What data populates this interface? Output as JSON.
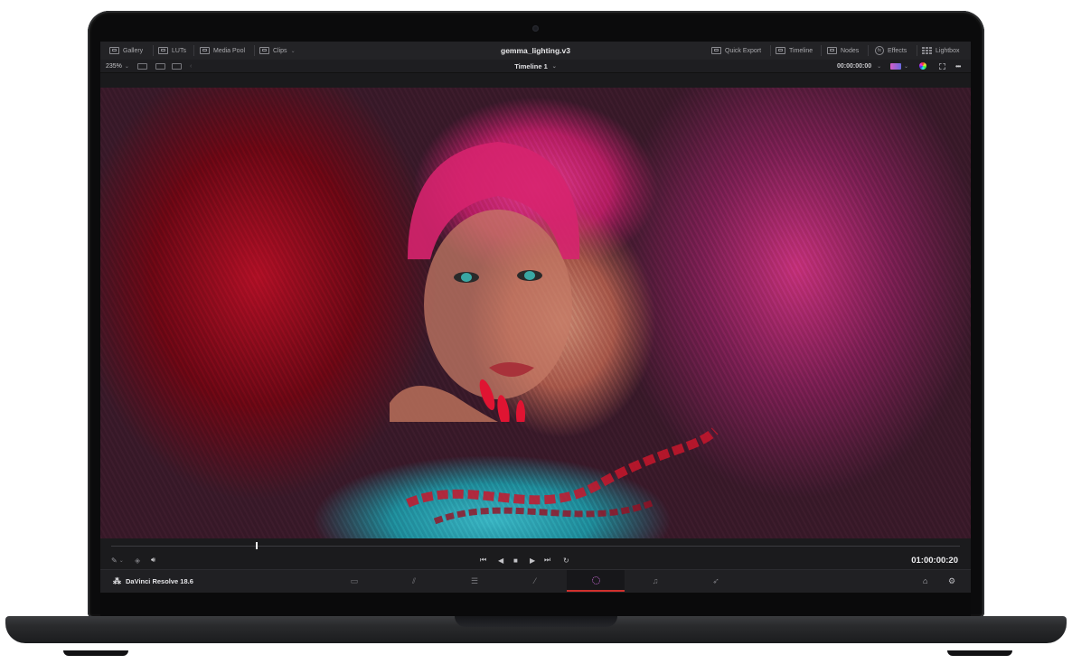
{
  "topbar": {
    "left_items": [
      {
        "label": "Gallery",
        "icon": "gallery-icon"
      },
      {
        "label": "LUTs",
        "icon": "luts-icon"
      },
      {
        "label": "Media Pool",
        "icon": "media-pool-icon"
      },
      {
        "label": "Clips",
        "icon": "clips-icon"
      }
    ],
    "project_title": "gemma_lighting.v3",
    "right_items": [
      {
        "label": "Quick Export",
        "icon": "quick-export-icon"
      },
      {
        "label": "Timeline",
        "icon": "timeline-icon"
      },
      {
        "label": "Nodes",
        "icon": "nodes-icon"
      },
      {
        "label": "Effects",
        "icon": "effects-icon"
      },
      {
        "label": "Lightbox",
        "icon": "lightbox-icon"
      }
    ]
  },
  "subbar": {
    "zoom": "235%",
    "timeline_name": "Timeline 1",
    "timecode": "00:00:00:00",
    "more": "•••"
  },
  "transport": {
    "timecode": "01:00:00:20",
    "playhead_fraction": 0.17
  },
  "pagebar": {
    "app_name": "DaVinci Resolve 18.6",
    "pages": [
      "media",
      "cut",
      "edit",
      "fusion",
      "color",
      "fairlight",
      "deliver"
    ],
    "active_page": "color"
  },
  "colors": {
    "accent_red": "#d0312d",
    "ui_bg": "#1a1a1c"
  }
}
